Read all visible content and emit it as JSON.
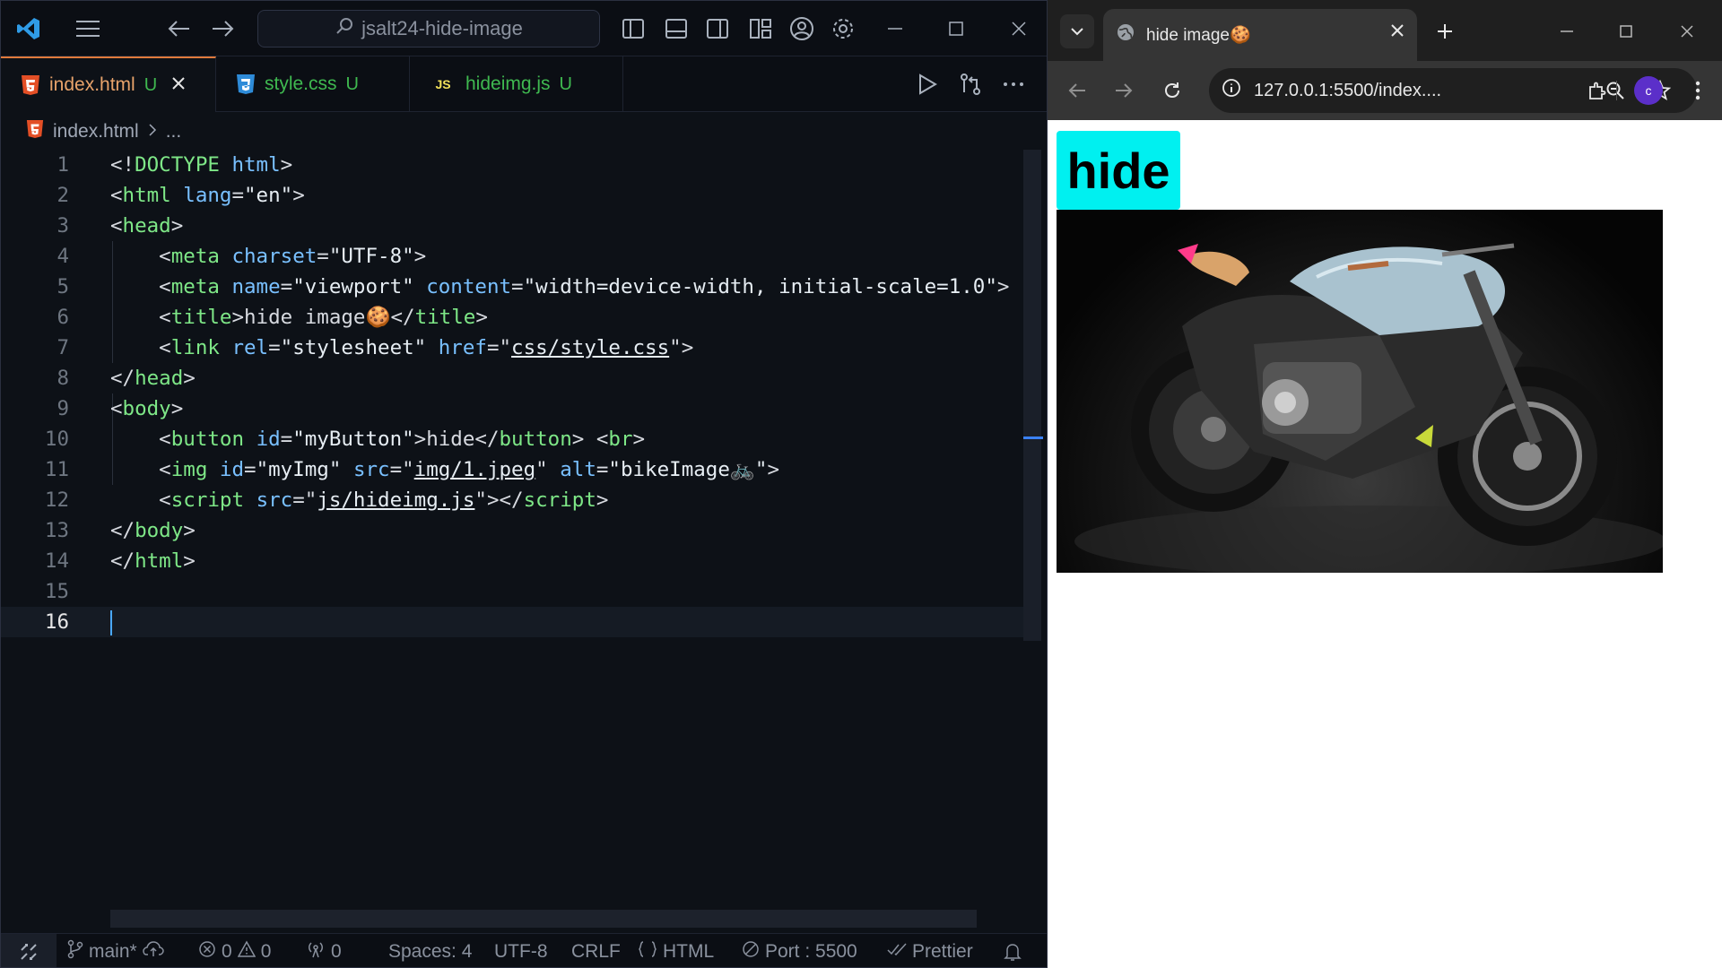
{
  "vscode": {
    "search_text": "jsalt24-hide-image",
    "tabs": [
      {
        "label": "index.html",
        "status": "U",
        "icon": "html5-icon"
      },
      {
        "label": "style.css",
        "status": "U",
        "icon": "css3-icon"
      },
      {
        "label": "hideimg.js",
        "status": "U",
        "icon": "js-icon",
        "icon_text": "JS"
      }
    ],
    "breadcrumb": {
      "file": "index.html",
      "rest": "..."
    },
    "lines": [
      {
        "n": "1",
        "tokens": [
          [
            "p",
            "<!"
          ],
          [
            "t",
            "DOCTYPE"
          ],
          [
            "p",
            " "
          ],
          [
            "a",
            "html"
          ],
          [
            "p",
            ">"
          ]
        ]
      },
      {
        "n": "2",
        "tokens": [
          [
            "p",
            "<"
          ],
          [
            "t",
            "html"
          ],
          [
            "p",
            " "
          ],
          [
            "a",
            "lang"
          ],
          [
            "p",
            "="
          ],
          [
            "s",
            "\"en\""
          ],
          [
            "p",
            ">"
          ]
        ]
      },
      {
        "n": "3",
        "tokens": [
          [
            "p",
            "<"
          ],
          [
            "t",
            "head"
          ],
          [
            "p",
            ">"
          ]
        ]
      },
      {
        "n": "4",
        "tokens": [
          [
            "p",
            "    <"
          ],
          [
            "t",
            "meta"
          ],
          [
            "p",
            " "
          ],
          [
            "a",
            "charset"
          ],
          [
            "p",
            "="
          ],
          [
            "s",
            "\"UTF-8\""
          ],
          [
            "p",
            ">"
          ]
        ]
      },
      {
        "n": "5",
        "tokens": [
          [
            "p",
            "    <"
          ],
          [
            "t",
            "meta"
          ],
          [
            "p",
            " "
          ],
          [
            "a",
            "name"
          ],
          [
            "p",
            "="
          ],
          [
            "s",
            "\"viewport\""
          ],
          [
            "p",
            " "
          ],
          [
            "a",
            "content"
          ],
          [
            "p",
            "="
          ],
          [
            "s",
            "\"width=device-width, initial-scale=1.0\""
          ],
          [
            "p",
            ">"
          ]
        ]
      },
      {
        "n": "6",
        "tokens": [
          [
            "p",
            "    <"
          ],
          [
            "t",
            "title"
          ],
          [
            "p",
            ">hide image"
          ],
          [
            "p",
            "🍪"
          ],
          [
            "p",
            "</"
          ],
          [
            "t",
            "title"
          ],
          [
            "p",
            ">"
          ]
        ]
      },
      {
        "n": "7",
        "tokens": [
          [
            "p",
            "    <"
          ],
          [
            "t",
            "link"
          ],
          [
            "p",
            " "
          ],
          [
            "a",
            "rel"
          ],
          [
            "p",
            "="
          ],
          [
            "s",
            "\"stylesheet\""
          ],
          [
            "p",
            " "
          ],
          [
            "a",
            "href"
          ],
          [
            "p",
            "=\""
          ],
          [
            "lk",
            "css/style.css"
          ],
          [
            "p",
            "\">"
          ]
        ]
      },
      {
        "n": "8",
        "tokens": [
          [
            "p",
            "</"
          ],
          [
            "t",
            "head"
          ],
          [
            "p",
            ">"
          ]
        ]
      },
      {
        "n": "9",
        "tokens": [
          [
            "p",
            "<"
          ],
          [
            "t",
            "body"
          ],
          [
            "p",
            ">"
          ]
        ]
      },
      {
        "n": "10",
        "tokens": [
          [
            "p",
            "    <"
          ],
          [
            "t",
            "button"
          ],
          [
            "p",
            " "
          ],
          [
            "a",
            "id"
          ],
          [
            "p",
            "="
          ],
          [
            "s",
            "\"myButton\""
          ],
          [
            "p",
            ">hide</"
          ],
          [
            "t",
            "button"
          ],
          [
            "p",
            "> <"
          ],
          [
            "t",
            "br"
          ],
          [
            "p",
            ">"
          ]
        ]
      },
      {
        "n": "11",
        "tokens": [
          [
            "p",
            "    <"
          ],
          [
            "t",
            "img"
          ],
          [
            "p",
            " "
          ],
          [
            "a",
            "id"
          ],
          [
            "p",
            "="
          ],
          [
            "s",
            "\"myImg\""
          ],
          [
            "p",
            " "
          ],
          [
            "a",
            "src"
          ],
          [
            "p",
            "=\""
          ],
          [
            "lk",
            "img/1.jpeg"
          ],
          [
            "p",
            "\" "
          ],
          [
            "a",
            "alt"
          ],
          [
            "p",
            "="
          ],
          [
            "s",
            "\"bikeImage🚲\""
          ],
          [
            "p",
            ">"
          ]
        ]
      },
      {
        "n": "12",
        "tokens": [
          [
            "p",
            "    <"
          ],
          [
            "t",
            "script"
          ],
          [
            "p",
            " "
          ],
          [
            "a",
            "src"
          ],
          [
            "p",
            "=\""
          ],
          [
            "lk",
            "js/hideimg.js"
          ],
          [
            "p",
            "\"></"
          ],
          [
            "t",
            "script"
          ],
          [
            "p",
            ">"
          ]
        ]
      },
      {
        "n": "13",
        "tokens": [
          [
            "p",
            "</"
          ],
          [
            "t",
            "body"
          ],
          [
            "p",
            ">"
          ]
        ]
      },
      {
        "n": "14",
        "tokens": [
          [
            "p",
            "</"
          ],
          [
            "t",
            "html"
          ],
          [
            "p",
            ">"
          ]
        ]
      },
      {
        "n": "15",
        "tokens": []
      },
      {
        "n": "16",
        "tokens": []
      }
    ],
    "current_line": "16",
    "status": {
      "branch": "main*",
      "errors": "0",
      "warnings": "0",
      "ports": "0",
      "spaces": "Spaces: 4",
      "encoding": "UTF-8",
      "eol": "CRLF",
      "language": "HTML",
      "port": "Port : 5500",
      "formatter": "Prettier"
    },
    "colors": {
      "tab_accent": "#e07a3b",
      "html_icon": "#e34f26",
      "css_icon": "#2e8bd8",
      "js_icon": "#f1e05a",
      "modified": "#3fb950"
    }
  },
  "browser": {
    "tab_title": "hide image🍪",
    "url": "127.0.0.1:5500/index....",
    "avatar_letter": "c",
    "page": {
      "button_label": "hide",
      "image_alt": "bikeImage🚲"
    },
    "colors": {
      "button_bg": "#00f0f0"
    }
  }
}
